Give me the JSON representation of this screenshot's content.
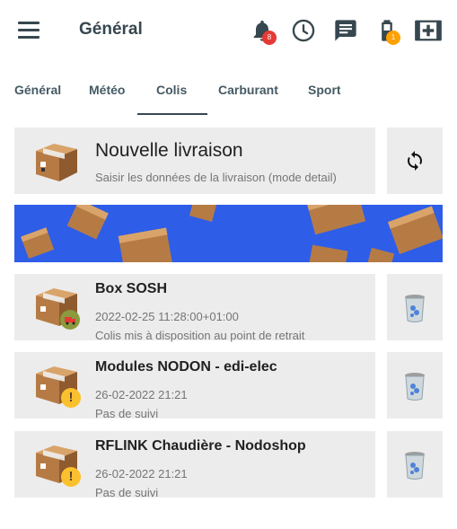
{
  "header": {
    "title": "Général",
    "notification_badge": "8",
    "battery_badge": "1",
    "icons": [
      "menu-icon",
      "bell-icon",
      "clock-icon",
      "message-icon",
      "battery-icon",
      "first-aid-icon"
    ],
    "notif_badge_color": "#e53935",
    "battery_badge_color": "#ffa000"
  },
  "tabs": [
    {
      "label": "Général"
    },
    {
      "label": "Météo"
    },
    {
      "label": "Colis"
    },
    {
      "label": "Carburant"
    },
    {
      "label": "Sport"
    }
  ],
  "active_tab": "Colis",
  "new_delivery": {
    "title": "Nouvelle livraison",
    "subtitle": "Saisir les données de la livraison (mode detail)"
  },
  "parcels": [
    {
      "title": "Box SOSH",
      "line1": "2022-02-25 11:28:00+01:00",
      "line2": "Colis mis à disposition au point de retrait",
      "status_icon": "delivery-truck-icon"
    },
    {
      "title": "Modules NODON - edi-elec",
      "line1": "26-02-2022 21:21",
      "line2": "Pas de suivi",
      "status_icon": "warning-icon"
    },
    {
      "title": "RFLINK Chaudière - Nodoshop",
      "line1": "26-02-2022 21:21",
      "line2": "Pas de suivi",
      "status_icon": "warning-icon"
    }
  ]
}
